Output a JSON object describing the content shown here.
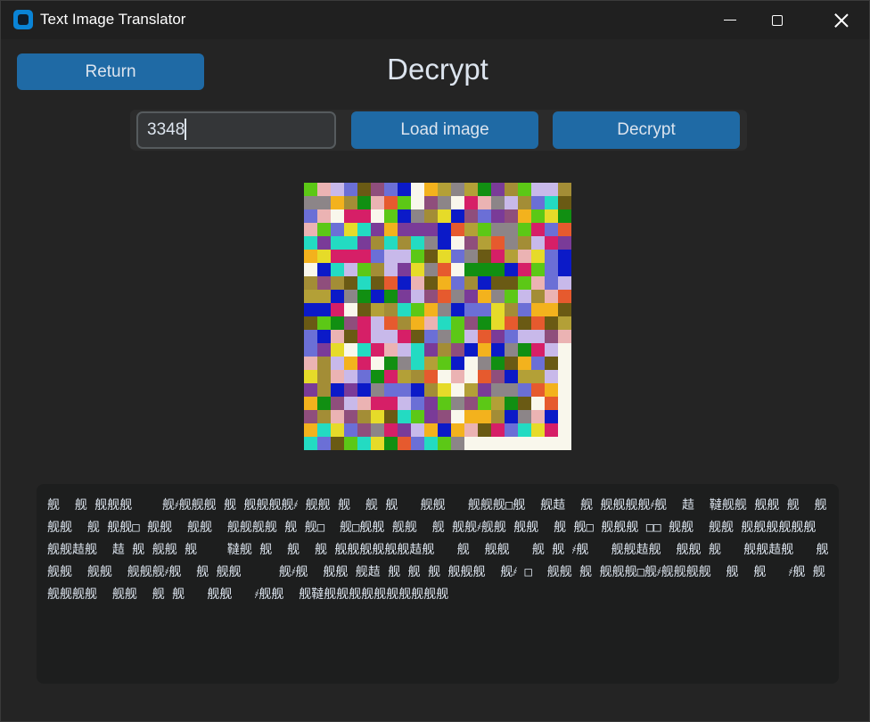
{
  "window": {
    "title": "Text Image Translator"
  },
  "header": {
    "return_label": "Return",
    "page_title": "Decrypt"
  },
  "toolbar": {
    "key_value": "3348",
    "load_label": "Load image",
    "decrypt_label": "Decrypt"
  },
  "image": {
    "description_colors": [
      "#f9f7ec",
      "#8c8588",
      "#a38d36",
      "#e6db29",
      "#e65a2e",
      "#8f4e7c",
      "#0b1ac8",
      "#5cc816",
      "#c8b9ea",
      "#7a3b98",
      "#ebb3b3",
      "#118f12",
      "#23dbc2",
      "#d61f67",
      "#6a5a14",
      "#b3a037",
      "#f3b21d",
      "#6b6fd6"
    ]
  },
  "output": {
    "text": "舰  舰 舰舰舰    舰҂舰舰舰 舰 舰舰舰舰҂ 舰舰 舰  舰 舰   舰舰   舰舰舰□舰  舰趌  舰 舰舰舰舰҂舰  趌  韃舰舰 舰舰 舰  舰 舰舰  舰 舰舰□ 舰舰  舰舰  舰舰舰舰 舰 舰□  舰□舰舰 舰舰  舰 舰舰҂舰舰 舰舰  舰 舰□ 舰舰舰 □□ 舰舰  舰舰 舰舰舰舰舰舰 舰舰趌舰  趌 舰 舰舰 舰    韃舰 舰  舰  舰 舰舰舰舰舰舰趌舰   舰  舰舰   舰 舰 ҂舰   舰舰趌舰  舰舰 舰   舰舰趌舰   舰舰舰  舰舰  舰舰舰҂舰  舰 舰舰     舰҂舰  舰舰 舰趌 舰 舰 舰 舰舰舰  舰҂ □  舰舰 舰 舰舰舰□舰҂舰舰舰舰  舰  舰   ҂舰 舰舰舰舰舰  舰舰  舰 舰   舰舰   ҂舰舰  舰韃舰舰舰舰舰舰舰舰舰舰"
  }
}
